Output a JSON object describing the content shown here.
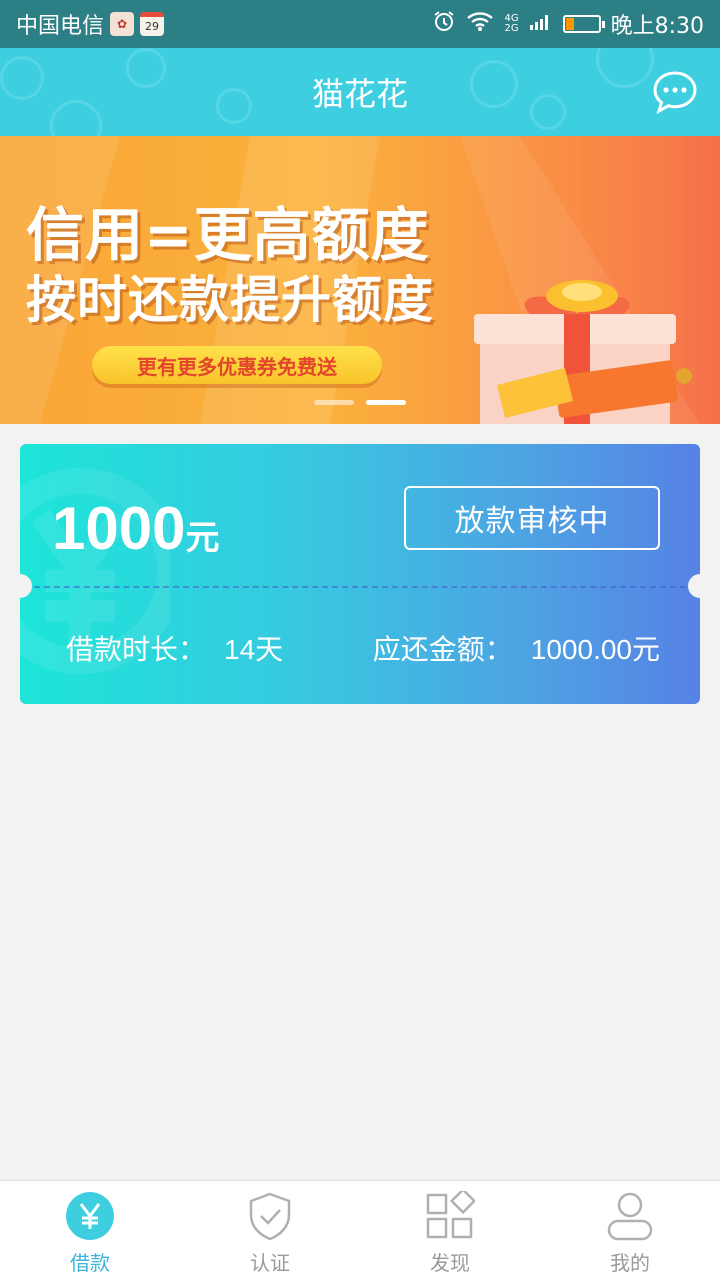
{
  "status_bar": {
    "carrier": "中国电信",
    "calendar_day": "29",
    "network_top": "4G",
    "network_bottom": "2G",
    "time": "晚上8:30",
    "battery_level": 0.25
  },
  "header": {
    "title": "猫花花",
    "chat_icon": "chat-bubble-icon"
  },
  "banner": {
    "line1": "信用=更高额度",
    "line2": "按时还款提升额度",
    "pill_text": "更有更多优惠券免费送",
    "active_slide_index": 1,
    "slide_count": 2
  },
  "loan_card": {
    "amount": "1000",
    "amount_unit": "元",
    "status_label": "放款审核中",
    "term_label": "借款时长：",
    "term_value": "14天",
    "repay_label": "应还金额：",
    "repay_value": "1000.00元"
  },
  "tabs": [
    {
      "label": "借款",
      "icon": "yuan-icon",
      "active": true
    },
    {
      "label": "认证",
      "icon": "shield-check-icon",
      "active": false
    },
    {
      "label": "发现",
      "icon": "grid-discover-icon",
      "active": false
    },
    {
      "label": "我的",
      "icon": "person-icon",
      "active": false
    }
  ],
  "colors": {
    "header_bg": "#3dcfe0",
    "status_bar_bg": "#2d7f86",
    "accent": "#3bb6d8",
    "card_gradient_start": "#1de5d9",
    "card_gradient_end": "#5682e6"
  }
}
